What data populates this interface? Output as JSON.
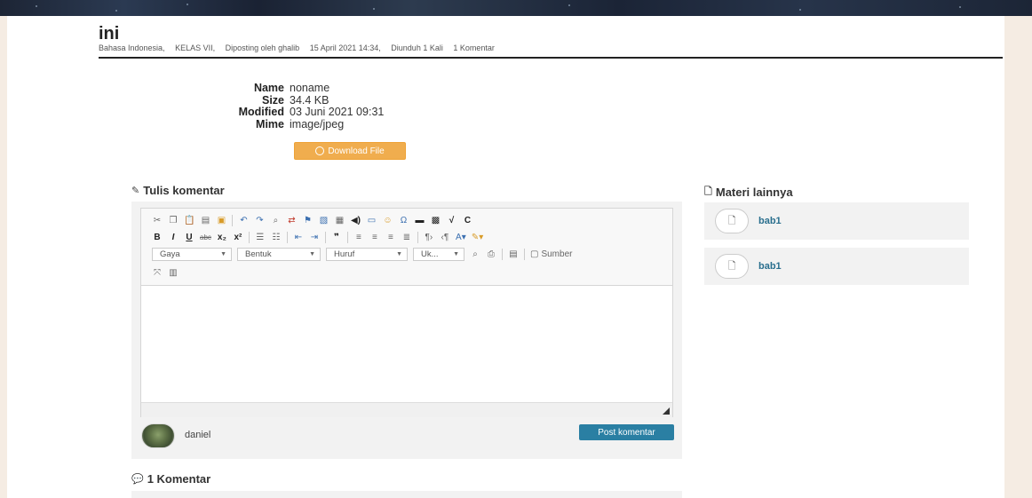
{
  "header": {
    "title": "ini",
    "meta": [
      "Bahasa Indonesia,",
      "KELAS VII,",
      "Diposting oleh ghalib",
      "15 April 2021 14:34,",
      "Diunduh 1 Kali",
      "1 Komentar"
    ]
  },
  "file_info": {
    "rows": [
      {
        "key": "Name",
        "value": "noname"
      },
      {
        "key": "Size",
        "value": "34.4 KB"
      },
      {
        "key": "Modified",
        "value": "03 Juni 2021 09:31"
      },
      {
        "key": "Mime",
        "value": "image/jpeg"
      }
    ],
    "download_label": "Download File"
  },
  "comment_form": {
    "heading": "Tulis komentar",
    "toolbar": {
      "combos": [
        "Gaya",
        "Bentuk",
        "Huruf",
        "Uk..."
      ],
      "source_label": "Sumber"
    },
    "editor_value": "",
    "user_name": "daniel",
    "post_label": "Post komentar"
  },
  "comments": {
    "heading": "1 Komentar"
  },
  "materi": {
    "heading": "Materi lainnya",
    "items": [
      {
        "label": "bab1"
      },
      {
        "label": "bab1"
      }
    ]
  },
  "colors": {
    "download_button": "#f0ad4e",
    "post_button": "#2a7fa3",
    "link": "#2a6f8e",
    "side_strip": "#f5ece3"
  }
}
